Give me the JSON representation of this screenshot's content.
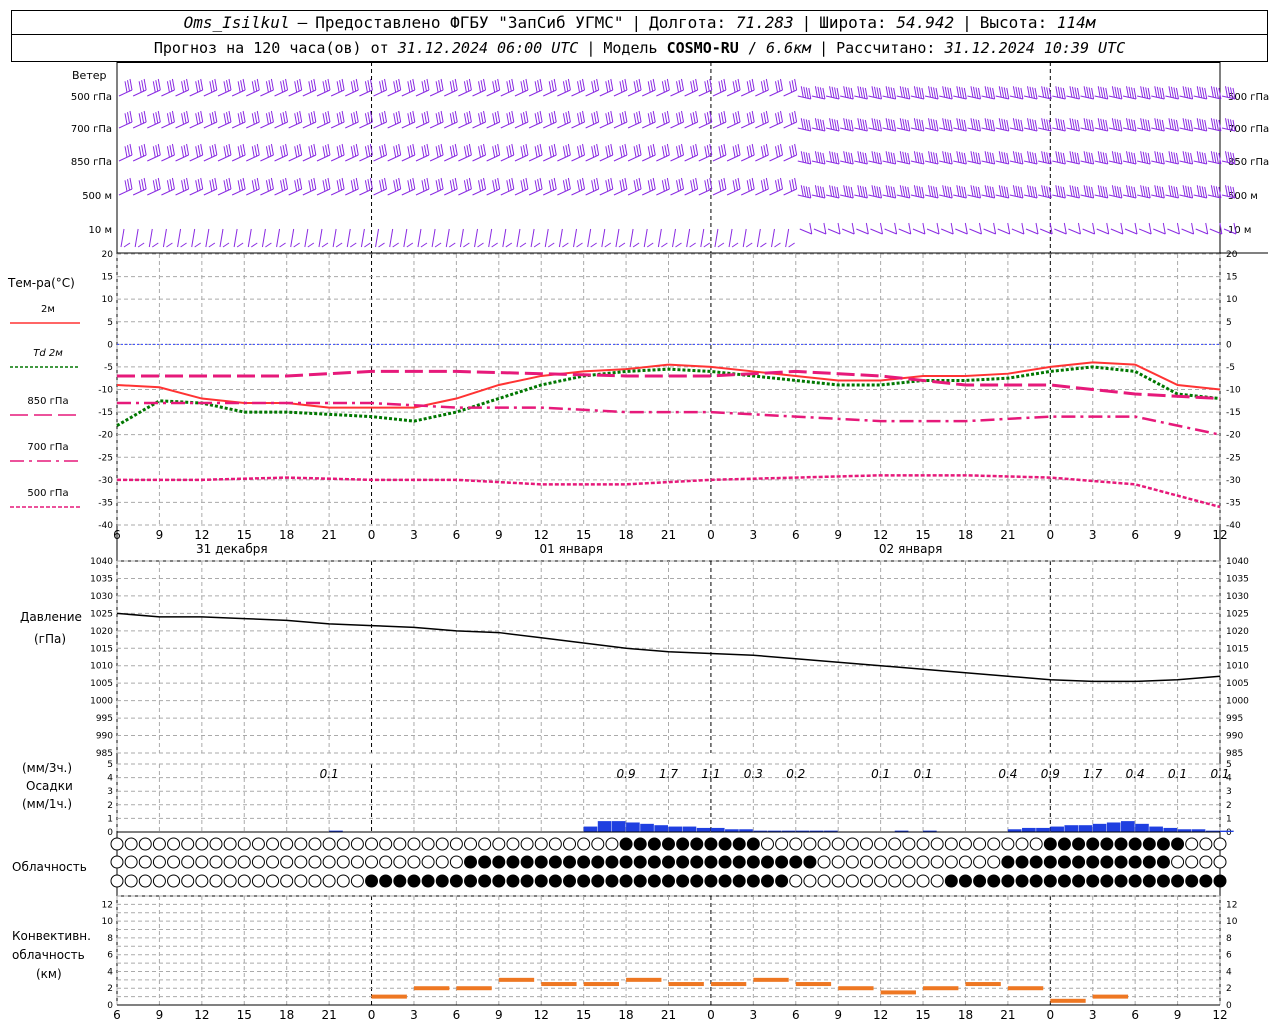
{
  "header": {
    "station": "Oms_Isilkul",
    "provider": "Предоставлено ФГБУ \"ЗапСиб УГМС\"",
    "lon_label": "Долгота:",
    "lon": "71.283",
    "lat_label": "Широта:",
    "lat": "54.942",
    "alt_label": "Высота:",
    "alt": "114м",
    "forecast_prefix": "Прогноз на 120 часа(ов) от",
    "forecast_time": "31.12.2024 06:00 UTC",
    "model_prefix": "Модель",
    "model": "COSMO-RU",
    "model_res": "6.6км",
    "calc_prefix": "Рассчитано:",
    "calc_time": "31.12.2024 10:39 UTC"
  },
  "wind": {
    "title": "Ветер",
    "levels": [
      "500 гПа",
      "700 гПа",
      "850 гПа",
      "500 м",
      "10 м"
    ],
    "color": "#8a2be2"
  },
  "temperature": {
    "title": "Тем-ра(°C)",
    "legend": [
      {
        "label": "2м",
        "color": "#ff3333",
        "style": "solid"
      },
      {
        "label": "Td 2м",
        "color": "#007700",
        "style": "dotted"
      },
      {
        "label": "850 гПа",
        "color": "#e6197a",
        "style": "dash"
      },
      {
        "label": "700 гПа",
        "color": "#e6197a",
        "style": "dashdot"
      },
      {
        "label": "500 гПа",
        "color": "#e6197a",
        "style": "dot"
      }
    ],
    "ylim": [
      -40,
      20
    ],
    "yticks": [
      "20",
      "15",
      "10",
      "5",
      "0",
      "-5",
      "-10",
      "-15",
      "-20",
      "-25",
      "-30",
      "-35",
      "-40"
    ]
  },
  "pressure": {
    "title": "Давление",
    "unit": "(гПа)",
    "ylim": [
      985,
      1040
    ],
    "yticks": [
      "1040",
      "1035",
      "1030",
      "1025",
      "1020",
      "1015",
      "1010",
      "1005",
      "1000",
      "995",
      "990",
      "985"
    ]
  },
  "precip": {
    "title_1": "(мм/3ч.)",
    "title_2": "Осадки",
    "title_3": "(мм/1ч.)",
    "ylim": [
      0,
      5
    ],
    "yticks": [
      "5",
      "4",
      "3",
      "2",
      "1",
      "0"
    ],
    "amounts": [
      {
        "h": 15,
        "v": "0.1"
      },
      {
        "h": 36,
        "v": "0.9"
      },
      {
        "h": 39,
        "v": "1.7"
      },
      {
        "h": 42,
        "v": "1.1"
      },
      {
        "h": 45,
        "v": "0.3"
      },
      {
        "h": 48,
        "v": "0.2"
      },
      {
        "h": 54,
        "v": "0.1"
      },
      {
        "h": 57,
        "v": "0.1"
      },
      {
        "h": 63,
        "v": "0.4"
      },
      {
        "h": 66,
        "v": "0.9"
      },
      {
        "h": 69,
        "v": "1.7"
      },
      {
        "h": 72,
        "v": "0.4"
      },
      {
        "h": 75,
        "v": "0.1"
      },
      {
        "h": 78,
        "v": "0.1"
      }
    ],
    "color": "#1f3fe0"
  },
  "clouds": {
    "title": "Облачность"
  },
  "convective": {
    "title_1": "Конвективн.",
    "title_2": "облачность",
    "title_3": "(км)",
    "ylim": [
      0,
      13
    ],
    "yticks": [
      "12",
      "10",
      "8",
      "6",
      "4",
      "2",
      "0"
    ],
    "color": "#ee7722"
  },
  "xaxis": {
    "tick_labels": [
      "6",
      "9",
      "12",
      "15",
      "18",
      "21",
      "0",
      "3",
      "6",
      "9",
      "12",
      "15",
      "18",
      "21",
      "0",
      "3",
      "6",
      "9",
      "12",
      "15",
      "18",
      "21",
      "0",
      "3",
      "6",
      "9",
      "12"
    ],
    "dates": [
      "31 декабря",
      "01 января",
      "02 января"
    ]
  },
  "chart_data": [
    {
      "type": "line",
      "title": "Тем-ра(°C)",
      "x_unit": "hours from 31.12.2024 06 UTC",
      "ylim": [
        -40,
        20
      ],
      "series": [
        {
          "name": "2м",
          "x": [
            0,
            3,
            6,
            9,
            12,
            15,
            18,
            21,
            24,
            27,
            30,
            33,
            36,
            39,
            42,
            45,
            48,
            51,
            54,
            57,
            60,
            63,
            66,
            69,
            72,
            75,
            78
          ],
          "values": [
            -9,
            -9.5,
            -12,
            -13,
            -13,
            -14,
            -14,
            -14,
            -12,
            -9,
            -7,
            -6,
            -5.5,
            -4.5,
            -5,
            -6,
            -7,
            -8,
            -8,
            -7,
            -7,
            -6.5,
            -5,
            -4,
            -4.5,
            -9,
            -10
          ]
        },
        {
          "name": "Td 2м",
          "x": [
            0,
            3,
            6,
            9,
            12,
            15,
            18,
            21,
            24,
            27,
            30,
            33,
            36,
            39,
            42,
            45,
            48,
            51,
            54,
            57,
            60,
            63,
            66,
            69,
            72,
            75,
            78
          ],
          "values": [
            -18,
            -12.5,
            -13,
            -15,
            -15,
            -15.5,
            -16,
            -17,
            -15,
            -12,
            -9,
            -7,
            -6,
            -5.5,
            -6,
            -7,
            -8,
            -9,
            -9,
            -8,
            -8,
            -7.5,
            -6,
            -5,
            -6,
            -11,
            -12
          ]
        },
        {
          "name": "850 гПа",
          "x": [
            0,
            6,
            12,
            18,
            24,
            30,
            36,
            42,
            48,
            54,
            60,
            66,
            72,
            78
          ],
          "values": [
            -7,
            -7,
            -7,
            -6,
            -6,
            -6.5,
            -7,
            -7,
            -6,
            -7,
            -9,
            -9,
            -11,
            -12
          ]
        },
        {
          "name": "700 гПа",
          "x": [
            0,
            6,
            12,
            18,
            24,
            30,
            36,
            42,
            48,
            54,
            60,
            66,
            72,
            78
          ],
          "values": [
            -13,
            -13,
            -13,
            -13,
            -14,
            -14,
            -15,
            -15,
            -16,
            -17,
            -17,
            -16,
            -16,
            -20
          ]
        },
        {
          "name": "500 гПа",
          "x": [
            0,
            6,
            12,
            18,
            24,
            30,
            36,
            42,
            48,
            54,
            60,
            66,
            72,
            78
          ],
          "values": [
            -30,
            -30,
            -29.5,
            -30,
            -30,
            -31,
            -31,
            -30,
            -29.5,
            -29,
            -29,
            -29.5,
            -31,
            -36
          ]
        }
      ]
    },
    {
      "type": "line",
      "title": "Давление",
      "ylim": [
        985,
        1040
      ],
      "series": [
        {
          "name": "",
          "x": [
            0,
            3,
            6,
            9,
            12,
            15,
            18,
            21,
            24,
            27,
            30,
            33,
            36,
            39,
            42,
            45,
            48,
            51,
            54,
            57,
            60,
            63,
            66,
            69,
            72,
            75,
            78
          ],
          "values": [
            1025,
            1024,
            1024,
            1023.5,
            1023,
            1022,
            1021.5,
            1021,
            1020,
            1019.5,
            1018,
            1016.5,
            1015,
            1014,
            1013.5,
            1013,
            1012,
            1011,
            1010,
            1009,
            1008,
            1007,
            1006,
            1005.5,
            1005.5,
            1006,
            1007
          ]
        }
      ]
    },
    {
      "type": "bar",
      "title": "Осадки",
      "x_unit": "hours from 31.12.2024 06 UTC",
      "series": [
        {
          "name": "",
          "x": [
            15,
            33,
            34,
            35,
            36,
            37,
            38,
            39,
            40,
            41,
            42,
            43,
            44,
            45,
            46,
            47,
            48,
            49,
            50,
            55,
            57,
            63,
            64,
            65,
            66,
            67,
            68,
            69,
            70,
            71,
            72,
            73,
            74,
            75,
            76,
            77,
            78
          ],
          "values": [
            0.1,
            0.4,
            0.8,
            0.8,
            0.7,
            0.6,
            0.5,
            0.4,
            0.4,
            0.3,
            0.3,
            0.2,
            0.2,
            0.1,
            0.1,
            0.1,
            0.1,
            0.1,
            0.1,
            0.1,
            0.1,
            0.2,
            0.3,
            0.3,
            0.4,
            0.5,
            0.5,
            0.6,
            0.7,
            0.8,
            0.6,
            0.4,
            0.3,
            0.2,
            0.2,
            0.1,
            0.1
          ]
        }
      ]
    },
    {
      "type": "bar",
      "title": "Конвективн. облачность",
      "series": [
        {
          "name": "",
          "x": [
            18,
            21,
            24,
            27,
            30,
            33,
            36,
            39,
            42,
            45,
            48,
            51,
            54,
            57,
            60,
            63,
            66,
            69
          ],
          "values": [
            1,
            2,
            2,
            3,
            2.5,
            2.5,
            3,
            2.5,
            2.5,
            3,
            2.5,
            2,
            1.5,
            2,
            2.5,
            2,
            0.5,
            1
          ]
        }
      ]
    }
  ]
}
